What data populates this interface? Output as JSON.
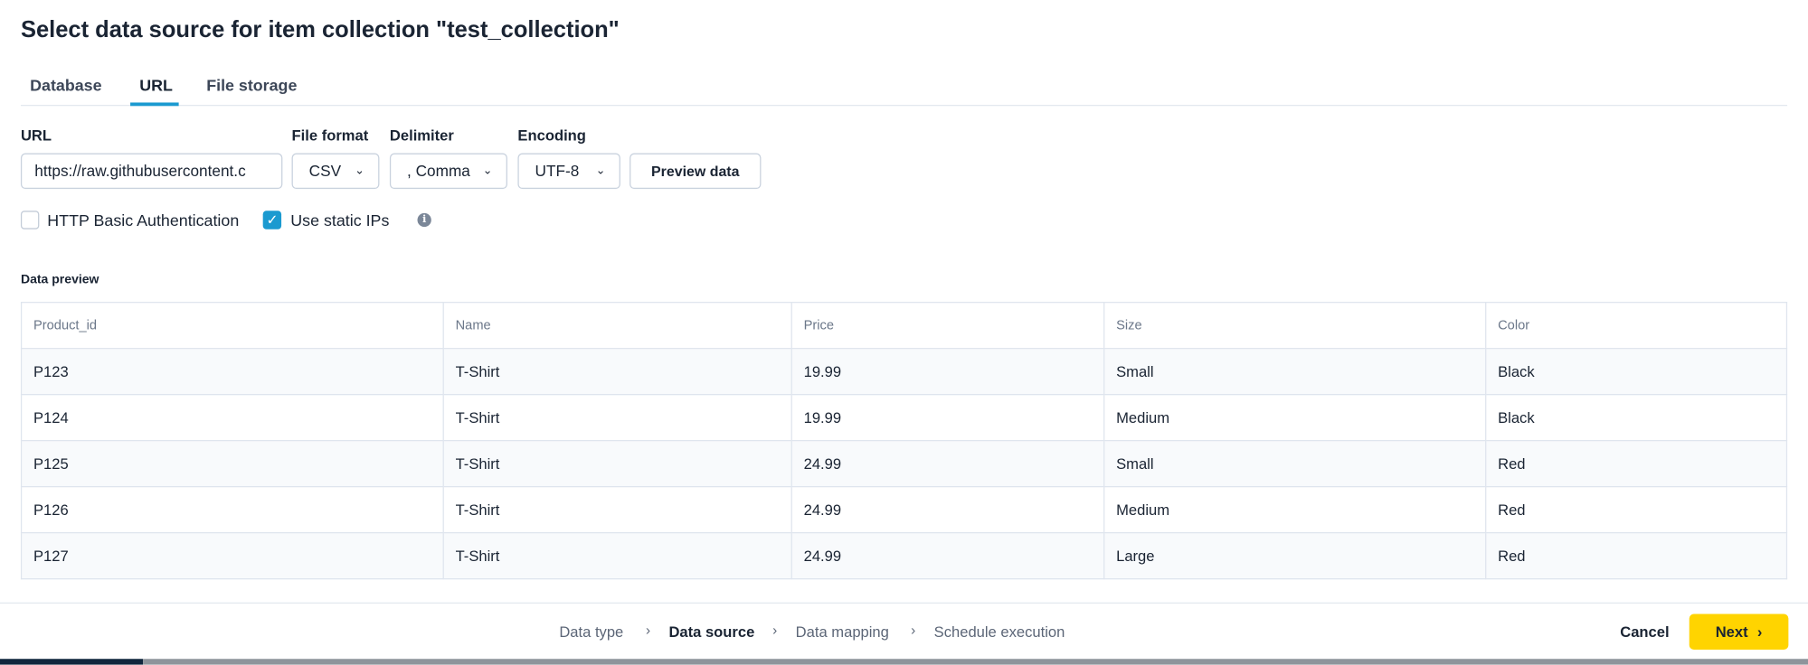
{
  "title": "Select data source for item collection \"test_collection\"",
  "tabs": [
    {
      "label": "Database"
    },
    {
      "label": "URL",
      "active": true
    },
    {
      "label": "File storage"
    }
  ],
  "form": {
    "url_label": "URL",
    "url_value": "https://raw.githubusercontent.c",
    "file_format_label": "File format",
    "file_format_value": "CSV",
    "delimiter_label": "Delimiter",
    "delimiter_value": ", Comma",
    "encoding_label": "Encoding",
    "encoding_value": "UTF-8",
    "preview_button": "Preview data",
    "basic_auth_label": "HTTP Basic Authentication",
    "basic_auth_checked": false,
    "static_ips_label": "Use static IPs",
    "static_ips_checked": true,
    "info_icon": "i"
  },
  "preview": {
    "title": "Data preview",
    "columns": [
      "Product_id",
      "Name",
      "Price",
      "Size",
      "Color"
    ],
    "rows": [
      [
        "P123",
        "T-Shirt",
        "19.99",
        "Small",
        "Black"
      ],
      [
        "P124",
        "T-Shirt",
        "19.99",
        "Medium",
        "Black"
      ],
      [
        "P125",
        "T-Shirt",
        "24.99",
        "Small",
        "Red"
      ],
      [
        "P126",
        "T-Shirt",
        "24.99",
        "Medium",
        "Red"
      ],
      [
        "P127",
        "T-Shirt",
        "24.99",
        "Large",
        "Red"
      ]
    ]
  },
  "footer": {
    "steps": [
      "Data type",
      "Data source",
      "Data mapping",
      "Schedule execution"
    ],
    "current_step": 1,
    "cancel": "Cancel",
    "next": "Next"
  },
  "colors": {
    "accent": "#1b9ad0",
    "primary_button": "#ffd400"
  }
}
